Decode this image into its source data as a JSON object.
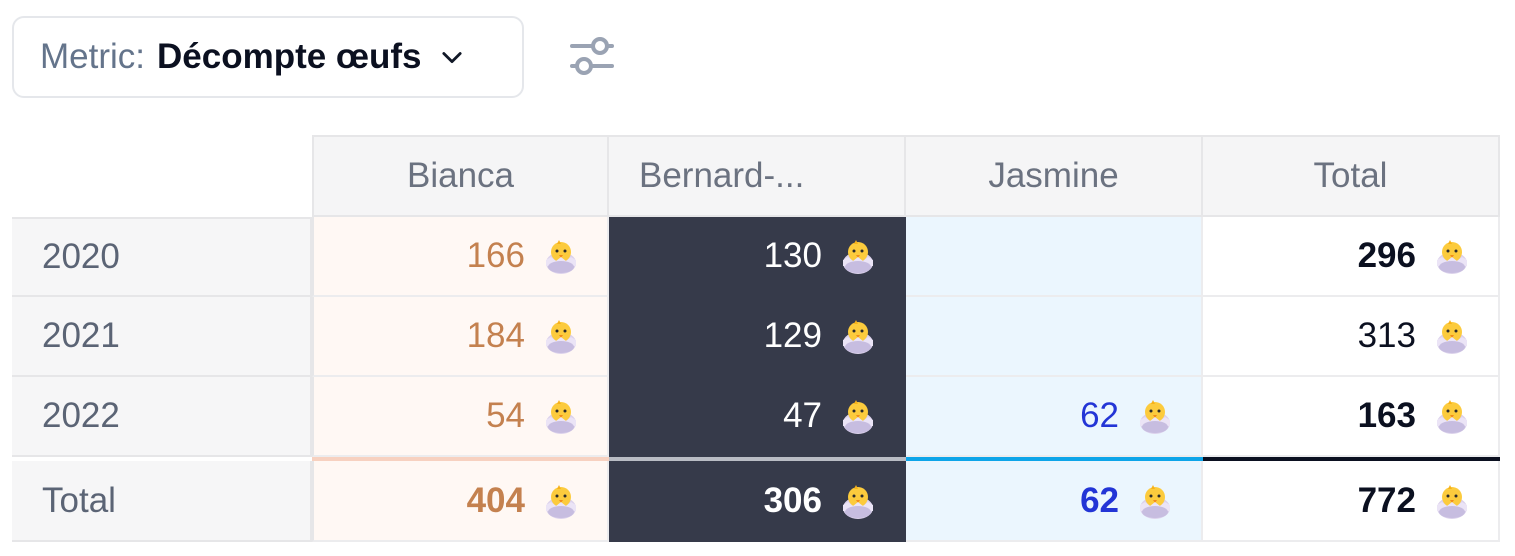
{
  "toolbar": {
    "metric_prefix": "Metric:",
    "metric_value": "Décompte œufs",
    "chevron_icon": "chevron-down-icon",
    "filter_icon": "sliders-icon"
  },
  "table": {
    "columns": [
      "Bianca",
      "Bernard-...",
      "Jasmine",
      "Total"
    ],
    "rows": [
      {
        "label": "2020",
        "bianca": "166",
        "bernard": "130",
        "jasmine": "",
        "total": "296"
      },
      {
        "label": "2021",
        "bianca": "184",
        "bernard": "129",
        "jasmine": "",
        "total": "313"
      },
      {
        "label": "2022",
        "bianca": "54",
        "bernard": "47",
        "jasmine": "62",
        "total": "163"
      }
    ],
    "totals": {
      "label": "Total",
      "bianca": "404",
      "bernard": "306",
      "jasmine": "62",
      "total": "772"
    }
  },
  "colors": {
    "bianca_text": "#c4814f",
    "bianca_bg": "#fff8f4",
    "bianca_accent": "#f7d1c0",
    "bernard_bg": "#363a4a",
    "bernard_accent": "#b9bcc4",
    "jasmine_text": "#2335d6",
    "jasmine_bg": "#ebf6fe",
    "jasmine_accent": "#0ea5e9",
    "total_accent": "#0b1020"
  },
  "icons": {
    "value_icon": "hatching-chick-icon"
  }
}
